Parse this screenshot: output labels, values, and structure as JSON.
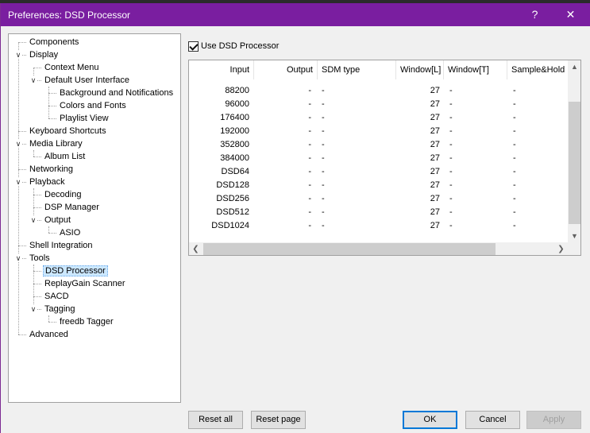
{
  "window": {
    "title": "Preferences: DSD Processor",
    "help_glyph": "?",
    "close_glyph": "✕"
  },
  "tree": {
    "items": [
      {
        "label": "Components"
      },
      {
        "label": "Display",
        "toggle": "∨"
      },
      {
        "label": "Context Menu"
      },
      {
        "label": "Default User Interface",
        "toggle": "∨"
      },
      {
        "label": "Background and Notifications"
      },
      {
        "label": "Colors and Fonts"
      },
      {
        "label": "Playlist View"
      },
      {
        "label": "Keyboard Shortcuts"
      },
      {
        "label": "Media Library",
        "toggle": "∨"
      },
      {
        "label": "Album List"
      },
      {
        "label": "Networking"
      },
      {
        "label": "Playback",
        "toggle": "∨"
      },
      {
        "label": "Decoding"
      },
      {
        "label": "DSP Manager"
      },
      {
        "label": "Output",
        "toggle": "∨"
      },
      {
        "label": "ASIO"
      },
      {
        "label": "Shell Integration"
      },
      {
        "label": "Tools",
        "toggle": "∨"
      },
      {
        "label": "DSD Processor",
        "selected": true
      },
      {
        "label": "ReplayGain Scanner"
      },
      {
        "label": "SACD"
      },
      {
        "label": "Tagging",
        "toggle": "∨"
      },
      {
        "label": "freedb Tagger"
      },
      {
        "label": "Advanced"
      }
    ]
  },
  "use_dsd": {
    "label": "Use DSD Processor",
    "checked": true
  },
  "grid": {
    "columns": [
      "Input",
      "Output",
      "SDM type",
      "Window[L]",
      "Window[T]",
      "Sample&Hold"
    ],
    "rows": [
      [
        "88200",
        "-",
        "-",
        "27",
        "-",
        "-"
      ],
      [
        "96000",
        "-",
        "-",
        "27",
        "-",
        "-"
      ],
      [
        "176400",
        "-",
        "-",
        "27",
        "-",
        "-"
      ],
      [
        "192000",
        "-",
        "-",
        "27",
        "-",
        "-"
      ],
      [
        "352800",
        "-",
        "-",
        "27",
        "-",
        "-"
      ],
      [
        "384000",
        "-",
        "-",
        "27",
        "-",
        "-"
      ],
      [
        "DSD64",
        "-",
        "-",
        "27",
        "-",
        "-"
      ],
      [
        "DSD128",
        "-",
        "-",
        "27",
        "-",
        "-"
      ],
      [
        "DSD256",
        "-",
        "-",
        "27",
        "-",
        "-"
      ],
      [
        "DSD512",
        "-",
        "-",
        "27",
        "-",
        "-"
      ],
      [
        "DSD1024",
        "-",
        "-",
        "27",
        "-",
        "-"
      ]
    ],
    "scroll_up": "▲",
    "scroll_down": "▼",
    "scroll_left": "❮",
    "scroll_right": "❯"
  },
  "buttons": {
    "reset_all": "Reset all",
    "reset_page": "Reset page",
    "ok": "OK",
    "cancel": "Cancel",
    "apply": "Apply"
  }
}
